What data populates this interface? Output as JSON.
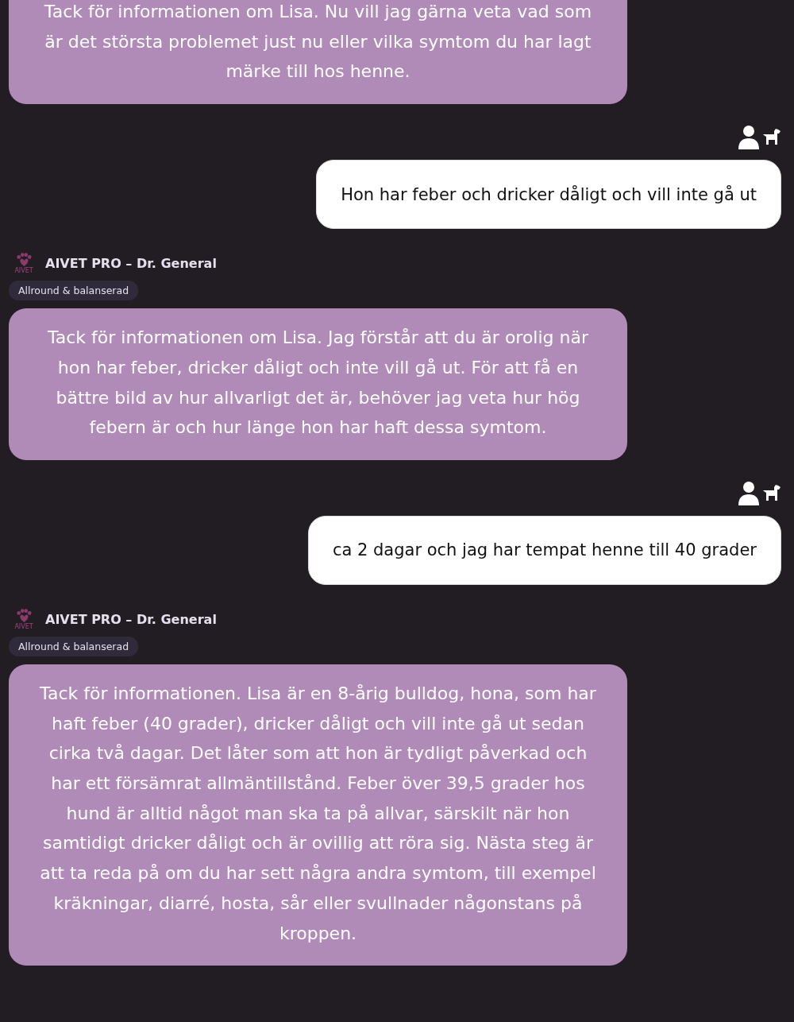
{
  "messages": [
    {
      "kind": "bot",
      "text": "Tack för informationen om Lisa. Nu vill jag gärna veta vad som är det största problemet just nu eller vilka symtom du har lagt märke till hos henne."
    },
    {
      "kind": "user",
      "text": "Hon har feber och dricker dåligt och vill inte gå ut"
    },
    {
      "kind": "bot",
      "logo_text": "AIVET",
      "sender": "AIVET PRO – Dr. General",
      "tag": "Allround & balanserad",
      "text": "Tack för informationen om Lisa. Jag förstår att du är orolig när hon har feber, dricker dåligt och inte vill gå ut. För att få en bättre bild av hur allvarligt det är, behöver jag veta hur hög febern är och hur länge hon har haft dessa symtom."
    },
    {
      "kind": "user",
      "text": "ca 2 dagar och jag har tempat henne till 40 grader"
    },
    {
      "kind": "bot",
      "logo_text": "AIVET",
      "sender": "AIVET PRO – Dr. General",
      "tag": "Allround & balanserad",
      "text": "Tack för informationen. Lisa är en 8-årig bulldog, hona, som har haft feber (40 grader), dricker dåligt och vill inte gå ut sedan cirka två dagar. Det låter som att hon är tydligt påverkad och har ett försämrat allmäntillstånd. Feber över 39,5 grader hos hund är alltid något man ska ta på allvar, särskilt när hon samtidigt dricker dåligt och är ovillig att röra sig. Nästa steg är att ta reda på om du har sett några andra symtom, till exempel kräkningar, diarré, hosta, sår eller svullnader någonstans på kroppen."
    }
  ]
}
